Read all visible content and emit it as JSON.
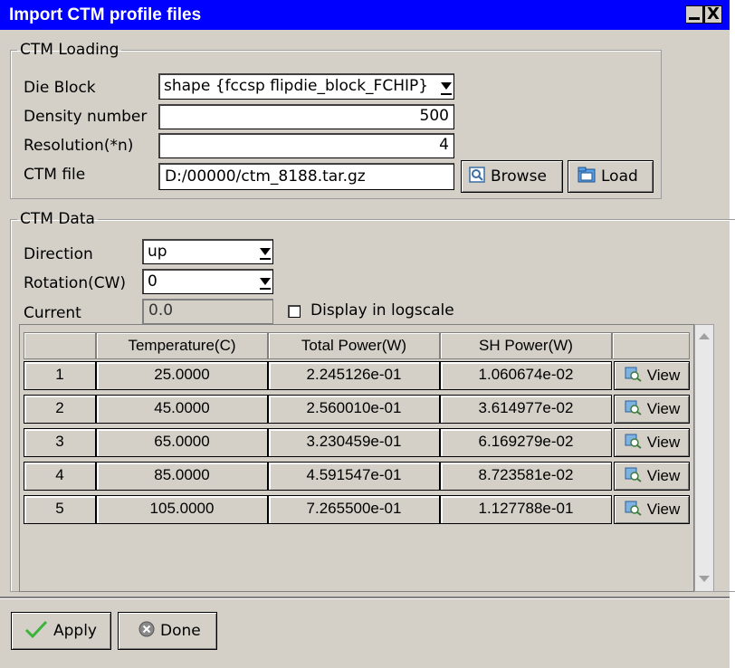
{
  "window": {
    "title": "Import CTM profile files",
    "minimize_glyph": "",
    "close_glyph": "X"
  },
  "ctm_loading": {
    "legend": "CTM Loading",
    "die_block_label": "Die Block",
    "die_block_value": "shape {fccsp flipdie_block_FCHIP}",
    "density_label": "Density number",
    "density_value": "500",
    "resolution_label": "Resolution(*n)",
    "resolution_value": "4",
    "ctm_file_label": "CTM file",
    "ctm_file_value": "D:/00000/ctm_8188.tar.gz",
    "browse_label": "Browse",
    "load_label": "Load"
  },
  "ctm_data": {
    "legend": "CTM Data",
    "direction_label": "Direction",
    "direction_value": "up",
    "rotation_label": "Rotation(CW)",
    "rotation_value": "0",
    "current_label": "Current",
    "current_value": "0.0",
    "logscale_label": "Display in logscale",
    "logscale_checked": false
  },
  "table": {
    "headers": [
      "",
      "Temperature(C)",
      "Total Power(W)",
      "SH Power(W)",
      ""
    ],
    "rows": [
      {
        "index": "1",
        "temperature": "25.0000",
        "total_power": "2.245126e-01",
        "sh_power": "1.060674e-02",
        "action": "View"
      },
      {
        "index": "2",
        "temperature": "45.0000",
        "total_power": "2.560010e-01",
        "sh_power": "3.614977e-02",
        "action": "View"
      },
      {
        "index": "3",
        "temperature": "65.0000",
        "total_power": "3.230459e-01",
        "sh_power": "6.169279e-02",
        "action": "View"
      },
      {
        "index": "4",
        "temperature": "85.0000",
        "total_power": "4.591547e-01",
        "sh_power": "8.723581e-02",
        "action": "View"
      },
      {
        "index": "5",
        "temperature": "105.0000",
        "total_power": "7.265500e-01",
        "sh_power": "1.127788e-01",
        "action": "View"
      }
    ]
  },
  "footer": {
    "apply_label": "Apply",
    "done_label": "Done"
  },
  "colors": {
    "titlebar": "#0000ff",
    "panel": "#d4d0c8",
    "apply_check": "#3cb43c"
  }
}
